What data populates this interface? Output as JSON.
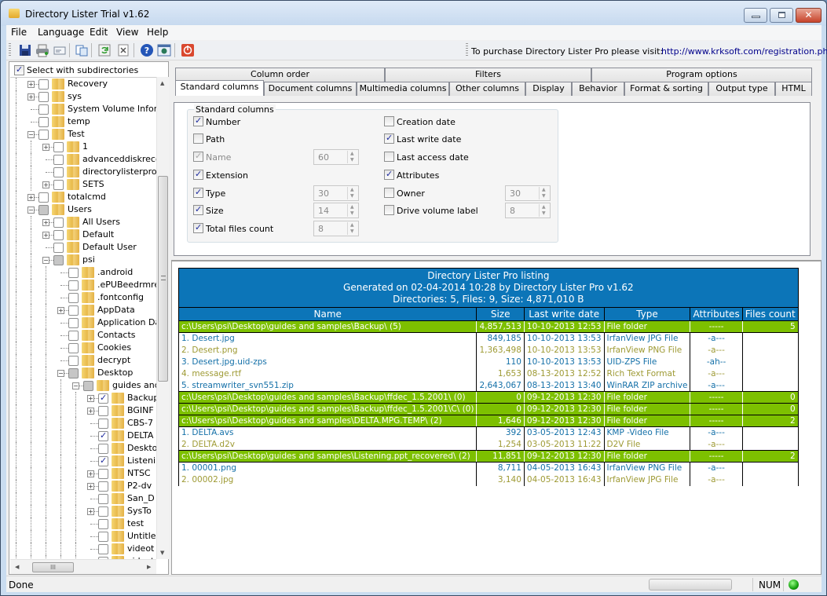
{
  "window": {
    "title": "Directory Lister Trial v1.62",
    "controls": {
      "minimize": "minimize",
      "maximize": "maximize",
      "close": "✕"
    }
  },
  "menu": [
    "File",
    "Language",
    "Edit",
    "View",
    "Help"
  ],
  "toolbar": {
    "buttons": [
      {
        "name": "save-icon"
      },
      {
        "name": "print-icon"
      },
      {
        "name": "email-icon"
      },
      {
        "name": "copy-icon"
      },
      {
        "name": "refresh-icon"
      },
      {
        "name": "clear-icon"
      },
      {
        "name": "help-icon"
      },
      {
        "name": "web-icon"
      },
      {
        "name": "exit-icon"
      }
    ],
    "purchase_text": "To purchase Directory Lister Pro please visit:",
    "purchase_link": "http://www.krksoft.com/registration.php"
  },
  "tree": {
    "select_with_subdirectories": "Select with subdirectories",
    "select_with_subdirectories_checked": true,
    "items": [
      {
        "label": "Recovery",
        "level": 0,
        "expander": "+",
        "state": "unchecked"
      },
      {
        "label": "sys",
        "level": 0,
        "expander": "+",
        "state": "unchecked"
      },
      {
        "label": "System Volume Inform",
        "level": 0,
        "expander": "",
        "state": "unchecked"
      },
      {
        "label": "temp",
        "level": 0,
        "expander": "",
        "state": "unchecked"
      },
      {
        "label": "Test",
        "level": 0,
        "expander": "-",
        "state": "unchecked"
      },
      {
        "label": "1",
        "level": 1,
        "expander": "+",
        "state": "unchecked"
      },
      {
        "label": "advanceddiskreco",
        "level": 1,
        "expander": "",
        "state": "unchecked"
      },
      {
        "label": "directorylisterpro",
        "level": 1,
        "expander": "",
        "state": "unchecked"
      },
      {
        "label": "SETS",
        "level": 1,
        "expander": "+",
        "state": "unchecked"
      },
      {
        "label": "totalcmd",
        "level": 0,
        "expander": "+",
        "state": "unchecked"
      },
      {
        "label": "Users",
        "level": 0,
        "expander": "-",
        "state": "partial"
      },
      {
        "label": "All Users",
        "level": 1,
        "expander": "+",
        "state": "unchecked"
      },
      {
        "label": "Default",
        "level": 1,
        "expander": "+",
        "state": "unchecked"
      },
      {
        "label": "Default User",
        "level": 1,
        "expander": "",
        "state": "unchecked"
      },
      {
        "label": "psi",
        "level": 1,
        "expander": "-",
        "state": "partial"
      },
      {
        "label": ".android",
        "level": 2,
        "expander": "",
        "state": "unchecked"
      },
      {
        "label": ".ePUBeedrmre",
        "level": 2,
        "expander": "",
        "state": "unchecked"
      },
      {
        "label": ".fontconfig",
        "level": 2,
        "expander": "",
        "state": "unchecked"
      },
      {
        "label": "AppData",
        "level": 2,
        "expander": "+",
        "state": "unchecked"
      },
      {
        "label": "Application Da",
        "level": 2,
        "expander": "",
        "state": "unchecked"
      },
      {
        "label": "Contacts",
        "level": 2,
        "expander": "",
        "state": "unchecked"
      },
      {
        "label": "Cookies",
        "level": 2,
        "expander": "",
        "state": "unchecked"
      },
      {
        "label": "decrypt",
        "level": 2,
        "expander": "",
        "state": "unchecked"
      },
      {
        "label": "Desktop",
        "level": 2,
        "expander": "-",
        "state": "partial"
      },
      {
        "label": "guides and",
        "level": 3,
        "expander": "-",
        "state": "partial"
      },
      {
        "label": "Backup",
        "level": 4,
        "expander": "+",
        "state": "checked"
      },
      {
        "label": "BGINF",
        "level": 4,
        "expander": "+",
        "state": "unchecked"
      },
      {
        "label": "CBS-7",
        "level": 4,
        "expander": "",
        "state": "unchecked"
      },
      {
        "label": "DELTA",
        "level": 4,
        "expander": "",
        "state": "checked"
      },
      {
        "label": "Deskto",
        "level": 4,
        "expander": "",
        "state": "unchecked"
      },
      {
        "label": "Listeni",
        "level": 4,
        "expander": "",
        "state": "checked"
      },
      {
        "label": "NTSC",
        "level": 4,
        "expander": "+",
        "state": "unchecked"
      },
      {
        "label": "P2-dv",
        "level": 4,
        "expander": "+",
        "state": "unchecked"
      },
      {
        "label": "San_D",
        "level": 4,
        "expander": "",
        "state": "unchecked"
      },
      {
        "label": "SysTo",
        "level": 4,
        "expander": "+",
        "state": "unchecked"
      },
      {
        "label": "test",
        "level": 4,
        "expander": "",
        "state": "unchecked"
      },
      {
        "label": "Untitle",
        "level": 4,
        "expander": "",
        "state": "unchecked"
      },
      {
        "label": "videot",
        "level": 4,
        "expander": "",
        "state": "unchecked"
      },
      {
        "label": "videot",
        "level": 4,
        "expander": "",
        "state": "unchecked"
      }
    ]
  },
  "tabs": {
    "row1": [
      "Column order",
      "Filters",
      "Program options"
    ],
    "row2": [
      "Standard columns",
      "Document columns",
      "Multimedia columns",
      "Other columns",
      "Display",
      "Behavior",
      "Format & sorting",
      "Output type",
      "HTML"
    ],
    "active": "Standard columns"
  },
  "standard_columns": {
    "group_title": "Standard columns",
    "left": [
      {
        "label": "Number",
        "checked": true,
        "disabled": false
      },
      {
        "label": "Path",
        "checked": false,
        "disabled": false
      },
      {
        "label": "Name",
        "checked": true,
        "disabled": true,
        "width": "60"
      },
      {
        "label": "Extension",
        "checked": true,
        "disabled": false
      },
      {
        "label": "Type",
        "checked": true,
        "disabled": false,
        "width": "30"
      },
      {
        "label": "Size",
        "checked": true,
        "disabled": false,
        "width": "14"
      },
      {
        "label": "Total files count",
        "checked": true,
        "disabled": false,
        "width": "8"
      }
    ],
    "right": [
      {
        "label": "Creation date",
        "checked": false
      },
      {
        "label": "Last write date",
        "checked": true
      },
      {
        "label": "Last access date",
        "checked": false
      },
      {
        "label": "Attributes",
        "checked": true
      },
      {
        "label": "Owner",
        "checked": false,
        "width": "30"
      },
      {
        "label": "Drive volume label",
        "checked": false,
        "width": "8"
      }
    ]
  },
  "listing": {
    "title": "Directory Lister Pro listing",
    "generated": "Generated on 02-04-2014 10:28 by Directory Lister Pro v1.62",
    "summary": "Directories: 5, Files: 9, Size: 4,871,010 B",
    "columns": [
      "Name",
      "Size",
      "Last write date",
      "Type",
      "Attributes",
      "Files count"
    ],
    "rows": [
      {
        "kind": "dir",
        "name": "c:\\Users\\psi\\Desktop\\guides and samples\\Backup\\ (5)",
        "size": "4,857,513",
        "date": "10-10-2013 12:53",
        "type": "File folder",
        "attr": "-----",
        "count": "5"
      },
      {
        "kind": "file",
        "color": "blue",
        "name": "1. Desert.jpg",
        "size": "849,185",
        "date": "10-10-2013 13:53",
        "type": "IrfanView JPG File",
        "attr": "-a---",
        "count": ""
      },
      {
        "kind": "file",
        "color": "olive",
        "name": "2. Desert.png",
        "size": "1,363,498",
        "date": "10-10-2013 13:53",
        "type": "IrfanView PNG File",
        "attr": "-a---",
        "count": ""
      },
      {
        "kind": "file",
        "color": "blue",
        "name": "3. Desert.jpg.uid-zps",
        "size": "110",
        "date": "10-10-2013 13:53",
        "type": "UID-ZPS File",
        "attr": "-ah--",
        "count": ""
      },
      {
        "kind": "file",
        "color": "olive",
        "name": "4. message.rtf",
        "size": "1,653",
        "date": "08-13-2013 12:52",
        "type": "Rich Text Format",
        "attr": "-a---",
        "count": ""
      },
      {
        "kind": "file",
        "color": "blue",
        "name": "5. streamwriter_svn551.zip",
        "size": "2,643,067",
        "date": "08-13-2013 13:40",
        "type": "WinRAR ZIP archive",
        "attr": "-a---",
        "count": ""
      },
      {
        "kind": "dir",
        "name": "c:\\Users\\psi\\Desktop\\guides and samples\\Backup\\ffdec_1.5.2001\\ (0)",
        "size": "0",
        "date": "09-12-2013 12:30",
        "type": "File folder",
        "attr": "-----",
        "count": "0"
      },
      {
        "kind": "dir",
        "name": "c:\\Users\\psi\\Desktop\\guides and samples\\Backup\\ffdec_1.5.2001\\C\\ (0)",
        "size": "0",
        "date": "09-12-2013 12:30",
        "type": "File folder",
        "attr": "-----",
        "count": "0"
      },
      {
        "kind": "dir",
        "name": "c:\\Users\\psi\\Desktop\\guides and samples\\DELTA.MPG.TEMP\\ (2)",
        "size": "1,646",
        "date": "09-12-2013 12:30",
        "type": "File folder",
        "attr": "-----",
        "count": "2"
      },
      {
        "kind": "file",
        "color": "blue",
        "name": "1. DELTA.avs",
        "size": "392",
        "date": "03-05-2013 12:43",
        "type": "KMP -Video File",
        "attr": "-a---",
        "count": ""
      },
      {
        "kind": "file",
        "color": "olive",
        "name": "2. DELTA.d2v",
        "size": "1,254",
        "date": "03-05-2013 11:22",
        "type": "D2V File",
        "attr": "-a---",
        "count": ""
      },
      {
        "kind": "dir",
        "name": "c:\\Users\\psi\\Desktop\\guides and samples\\Listening.ppt_recovered\\ (2)",
        "size": "11,851",
        "date": "09-12-2013 12:30",
        "type": "File folder",
        "attr": "-----",
        "count": "2"
      },
      {
        "kind": "file",
        "color": "blue",
        "name": "1. 00001.png",
        "size": "8,711",
        "date": "04-05-2013 16:43",
        "type": "IrfanView PNG File",
        "attr": "-a---",
        "count": ""
      },
      {
        "kind": "file",
        "color": "olive",
        "name": "2. 00002.jpg",
        "size": "3,140",
        "date": "04-05-2013 16:43",
        "type": "IrfanView JPG File",
        "attr": "-a---",
        "count": ""
      }
    ]
  },
  "status": {
    "text": "Done",
    "num_indicator": "NUM",
    "led_color": "#15a10e"
  },
  "colors": {
    "header_blue": "#0c75b8",
    "folder_green": "#7dc000",
    "file_blue": "#1470a8",
    "file_olive": "#9e9a34",
    "link": "#00008b"
  }
}
